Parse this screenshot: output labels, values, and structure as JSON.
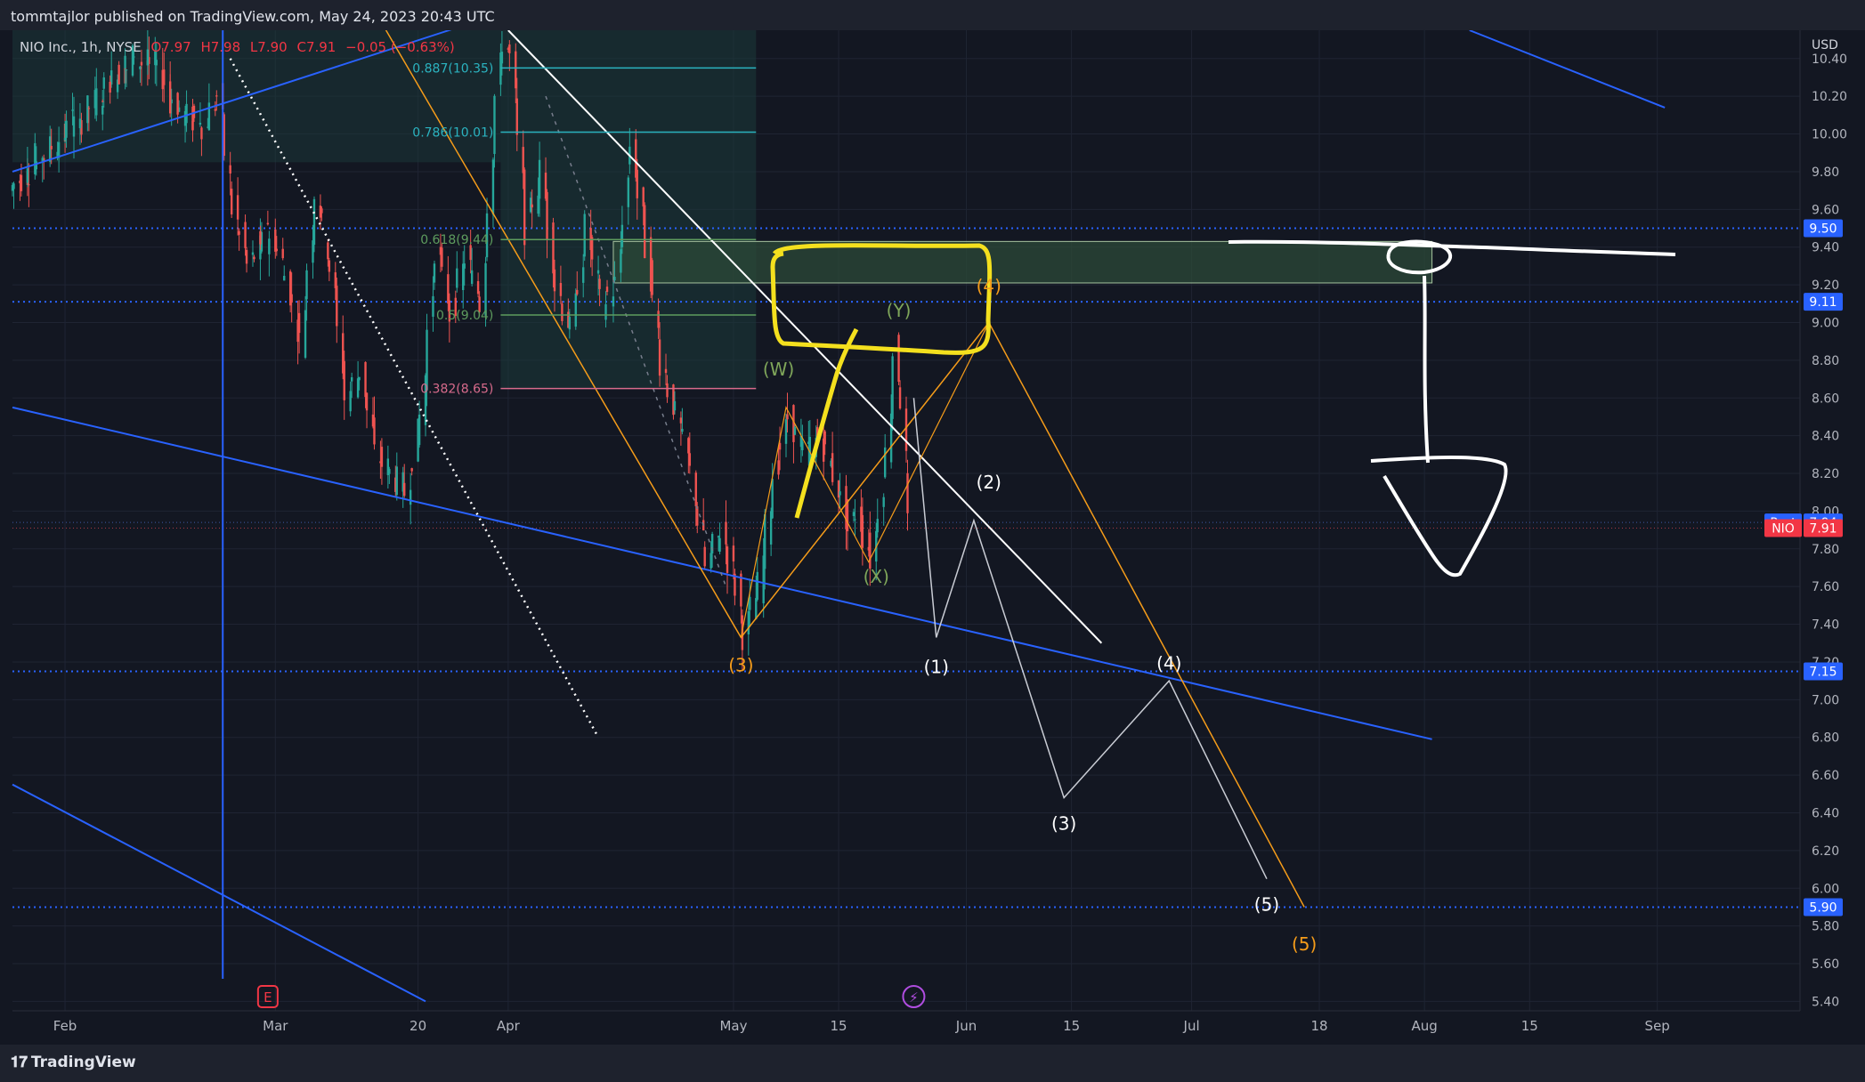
{
  "header": {
    "publisher": "tommtajlor published on TradingView.com, May 24, 2023 20:43 UTC"
  },
  "legend": {
    "symbol": "NIO Inc., 1h, NYSE",
    "open": "O7.97",
    "high": "H7.98",
    "low": "L7.90",
    "close": "C7.91",
    "change": "−0.05 (−0.63%)"
  },
  "footer": {
    "brand": "TradingView"
  },
  "colors": {
    "background": "#131722",
    "grid": "#1f2433",
    "candle_up": "#26a69a",
    "candle_down": "#ef5350",
    "trendline": "#2962ff",
    "fib_zone": "#1d3b30",
    "wave_orange": "#f59c1a",
    "wave_green": "#7fa65a",
    "highlight_yellow": "#f4e01e",
    "price_tag_blue": "#2962ff",
    "price_tag_red": "#f23645"
  },
  "chart_data": {
    "type": "candlestick",
    "currency": "USD",
    "ylim": [
      5.35,
      10.55
    ],
    "y_ticks": [
      10.4,
      10.2,
      10.0,
      9.8,
      9.6,
      9.4,
      9.2,
      9.0,
      8.8,
      8.6,
      8.4,
      8.2,
      8.0,
      7.8,
      7.6,
      7.4,
      7.2,
      7.0,
      6.8,
      6.6,
      6.4,
      6.2,
      6.0,
      5.8,
      5.6,
      5.4
    ],
    "y_tick_labels": [
      "10.40",
      "10.20",
      "10.00",
      "9.80",
      "9.60",
      "9.40",
      "9.20",
      "9.00",
      "8.80",
      "8.60",
      "8.40",
      "8.20",
      "8.00",
      "7.80",
      "7.60",
      "7.40",
      "7.20",
      "7.00",
      "6.80",
      "6.60",
      "6.40",
      "6.20",
      "6.00",
      "5.80",
      "5.60",
      "5.40"
    ],
    "x_range": [
      "2023-01-25",
      "2023-09-20"
    ],
    "x_ticks": [
      {
        "date": "2023-02-01",
        "label": "Feb"
      },
      {
        "date": "2023-03-01",
        "label": "Mar"
      },
      {
        "date": "2023-03-20",
        "label": "20"
      },
      {
        "date": "2023-04-01",
        "label": "Apr"
      },
      {
        "date": "2023-05-01",
        "label": "May"
      },
      {
        "date": "2023-05-15",
        "label": "15"
      },
      {
        "date": "2023-06-01",
        "label": "Jun"
      },
      {
        "date": "2023-06-15",
        "label": "15"
      },
      {
        "date": "2023-07-01",
        "label": "Jul"
      },
      {
        "date": "2023-07-18",
        "label": "18"
      },
      {
        "date": "2023-08-01",
        "label": "Aug"
      },
      {
        "date": "2023-08-15",
        "label": "15"
      },
      {
        "date": "2023-09-01",
        "label": "Sep"
      }
    ],
    "price_path": [
      [
        "2023-01-25",
        9.7
      ],
      [
        "2023-01-30",
        9.9
      ],
      [
        "2023-02-04",
        10.1
      ],
      [
        "2023-02-08",
        10.3
      ],
      [
        "2023-02-11",
        10.4
      ],
      [
        "2023-02-14",
        10.35
      ],
      [
        "2023-02-17",
        10.1
      ],
      [
        "2023-02-20",
        10.05
      ],
      [
        "2023-02-22",
        10.2
      ],
      [
        "2023-02-24",
        9.6
      ],
      [
        "2023-02-26",
        9.3
      ],
      [
        "2023-03-01",
        9.5
      ],
      [
        "2023-03-03",
        9.25
      ],
      [
        "2023-03-05",
        8.9
      ],
      [
        "2023-03-07",
        9.7
      ],
      [
        "2023-03-09",
        9.3
      ],
      [
        "2023-03-11",
        8.6
      ],
      [
        "2023-03-13",
        8.75
      ],
      [
        "2023-03-15",
        8.3
      ],
      [
        "2023-03-17",
        8.2
      ],
      [
        "2023-03-19",
        8.1
      ],
      [
        "2023-03-21",
        8.5
      ],
      [
        "2023-03-23",
        9.4
      ],
      [
        "2023-03-25",
        9.05
      ],
      [
        "2023-03-27",
        9.35
      ],
      [
        "2023-03-29",
        9.1
      ],
      [
        "2023-03-31",
        10.2
      ],
      [
        "2023-04-01",
        10.5
      ],
      [
        "2023-04-02",
        10.4
      ],
      [
        "2023-04-04",
        9.5
      ],
      [
        "2023-04-06",
        9.8
      ],
      [
        "2023-04-08",
        9.2
      ],
      [
        "2023-04-10",
        8.95
      ],
      [
        "2023-04-12",
        9.5
      ],
      [
        "2023-04-14",
        9.1
      ],
      [
        "2023-04-16",
        9.2
      ],
      [
        "2023-04-18",
        9.95
      ],
      [
        "2023-04-20",
        9.4
      ],
      [
        "2023-04-22",
        8.8
      ],
      [
        "2023-04-24",
        8.5
      ],
      [
        "2023-04-26",
        8.2
      ],
      [
        "2023-04-28",
        7.7
      ],
      [
        "2023-04-30",
        7.9
      ],
      [
        "2023-05-02",
        7.6
      ],
      [
        "2023-05-03",
        7.35
      ],
      [
        "2023-05-05",
        7.6
      ],
      [
        "2023-05-07",
        8.2
      ],
      [
        "2023-05-09",
        8.5
      ],
      [
        "2023-05-11",
        8.3
      ],
      [
        "2023-05-13",
        8.4
      ],
      [
        "2023-05-15",
        8.2
      ],
      [
        "2023-05-17",
        7.9
      ],
      [
        "2023-05-18",
        8.0
      ],
      [
        "2023-05-20",
        7.75
      ],
      [
        "2023-05-22",
        8.3
      ],
      [
        "2023-05-23",
        8.85
      ],
      [
        "2023-05-24",
        8.6
      ],
      [
        "2023-05-25",
        7.91
      ]
    ],
    "horizontal_levels": [
      9.5,
      9.11,
      7.15,
      5.9
    ],
    "price_labels": [
      {
        "label": "Post",
        "price": 7.94,
        "value": "7.94"
      },
      {
        "label": "NIO",
        "price": 7.91,
        "value": "7.91"
      },
      {
        "label": "",
        "price": 9.5,
        "value": "9.50"
      },
      {
        "label": "",
        "price": 9.11,
        "value": "9.11"
      },
      {
        "label": "",
        "price": 7.15,
        "value": "7.15"
      },
      {
        "label": "",
        "price": 5.9,
        "value": "5.90"
      }
    ],
    "fib_levels": [
      {
        "label": "0.887(10.35)",
        "price": 10.35
      },
      {
        "label": "0.786(10.01)",
        "price": 10.01
      },
      {
        "label": "0.618(9.44)",
        "price": 9.44
      },
      {
        "label": "0.5(9.04)",
        "price": 9.04
      },
      {
        "label": "0.382(8.65)",
        "price": 8.65
      }
    ],
    "fib_range": [
      "2023-03-31",
      "2023-05-04"
    ],
    "resistance_zone": {
      "from": "2023-04-15",
      "to": "2023-08-02",
      "top": 9.43,
      "bottom": 9.21
    },
    "trendlines": [
      {
        "style": "solid",
        "color": "blue",
        "points": [
          [
            "2023-01-25",
            9.8
          ],
          [
            "2023-03-28",
            10.6
          ]
        ]
      },
      {
        "style": "solid",
        "color": "blue",
        "points": [
          [
            "2023-01-25",
            8.55
          ],
          [
            "2023-08-02",
            6.79
          ]
        ]
      },
      {
        "style": "solid",
        "color": "blue",
        "points": [
          [
            "2023-01-25",
            6.55
          ],
          [
            "2023-03-21",
            5.4
          ]
        ]
      },
      {
        "style": "solid",
        "color": "blue",
        "points": [
          [
            "2023-08-07",
            10.55
          ],
          [
            "2023-09-02",
            10.14
          ]
        ]
      },
      {
        "style": "vertical",
        "color": "blue",
        "date": "2023-02-22",
        "from": 10.55,
        "to": 5.52
      },
      {
        "style": "dotted",
        "color": "white",
        "points": [
          [
            "2023-02-23",
            10.4
          ],
          [
            "2023-04-13",
            6.8
          ]
        ]
      },
      {
        "style": "solid",
        "color": "white",
        "points": [
          [
            "2023-04-01",
            10.55
          ],
          [
            "2023-06-19",
            7.3
          ]
        ]
      },
      {
        "style": "dashed",
        "color": "grey",
        "points": [
          [
            "2023-04-06",
            10.2
          ],
          [
            "2023-04-30",
            7.6
          ]
        ]
      }
    ],
    "wave_paths": [
      {
        "color": "orange",
        "points": [
          [
            "2023-03-15",
            10.6
          ],
          [
            "2023-05-02",
            7.33
          ],
          [
            "2023-06-04",
            9.0
          ],
          [
            "2023-07-16",
            5.9
          ]
        ]
      },
      {
        "color": "orange_thin",
        "points": [
          [
            "2023-05-02",
            7.33
          ],
          [
            "2023-05-08",
            8.55
          ],
          [
            "2023-05-19",
            7.73
          ],
          [
            "2023-06-04",
            9.0
          ]
        ]
      },
      {
        "color": "white",
        "points": [
          [
            "2023-05-25",
            8.6
          ],
          [
            "2023-05-28",
            7.33
          ],
          [
            "2023-06-02",
            7.95
          ],
          [
            "2023-06-14",
            6.48
          ],
          [
            "2023-06-28",
            7.1
          ],
          [
            "2023-07-11",
            6.05
          ]
        ]
      }
    ],
    "labels": [
      {
        "text": "(W)",
        "date": "2023-05-07",
        "price": 8.72,
        "color": "green"
      },
      {
        "text": "(X)",
        "date": "2023-05-20",
        "price": 7.62,
        "color": "green"
      },
      {
        "text": "(Y)",
        "date": "2023-05-23",
        "price": 9.03,
        "color": "green"
      },
      {
        "text": "(3)",
        "date": "2023-05-02",
        "price": 7.15,
        "color": "orange"
      },
      {
        "text": "(4)",
        "date": "2023-06-04",
        "price": 9.16,
        "color": "orange"
      },
      {
        "text": "(5)",
        "date": "2023-07-16",
        "price": 5.67,
        "color": "orange"
      },
      {
        "text": "(1)",
        "date": "2023-05-28",
        "price": 7.14,
        "color": "white"
      },
      {
        "text": "(2)",
        "date": "2023-06-04",
        "price": 8.12,
        "color": "white"
      },
      {
        "text": "(3)",
        "date": "2023-06-14",
        "price": 6.31,
        "color": "white"
      },
      {
        "text": "(4)",
        "date": "2023-06-28",
        "price": 7.16,
        "color": "white"
      },
      {
        "text": "(5)",
        "date": "2023-07-11",
        "price": 5.88,
        "color": "white"
      }
    ],
    "event_markers": [
      {
        "text": "E",
        "date": "2023-02-28"
      },
      {
        "text": "⚡",
        "date": "2023-05-25"
      }
    ]
  }
}
